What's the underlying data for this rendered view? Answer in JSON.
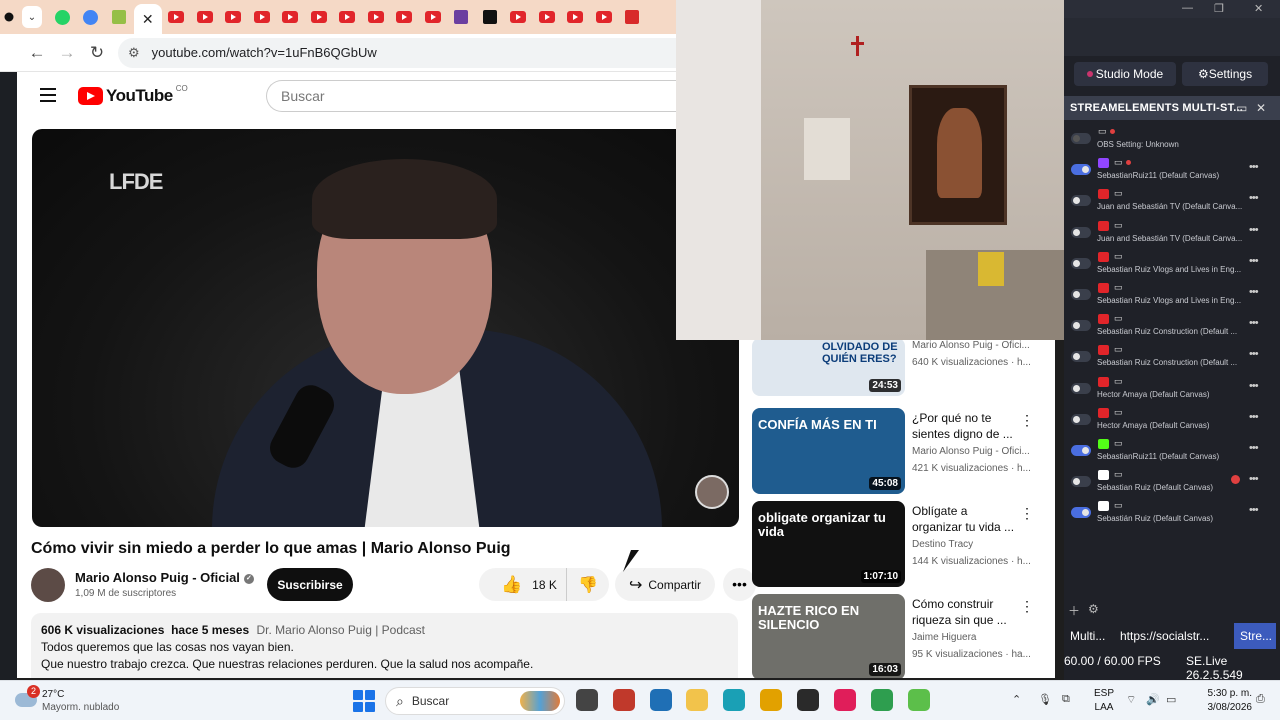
{
  "browser": {
    "tabs": [
      {
        "icon": "whatsapp-icon",
        "color": "#25d366",
        "kind": "round"
      },
      {
        "icon": "google-icon",
        "color": "#4285f4",
        "kind": "round"
      },
      {
        "icon": "shopify-icon",
        "color": "#95bf47",
        "kind": "sq"
      },
      {
        "icon": "close-icon",
        "color": "#222222",
        "kind": "active"
      },
      {
        "icon": "youtube-icon",
        "color": "#e1252a",
        "kind": "yt"
      },
      {
        "icon": "youtube-icon",
        "color": "#e1252a",
        "kind": "yt"
      },
      {
        "icon": "youtube-icon",
        "color": "#e1252a",
        "kind": "yt"
      },
      {
        "icon": "youtube-icon",
        "color": "#e1252a",
        "kind": "yt"
      },
      {
        "icon": "youtube-icon",
        "color": "#e1252a",
        "kind": "yt"
      },
      {
        "icon": "youtube-icon",
        "color": "#e1252a",
        "kind": "yt"
      },
      {
        "icon": "youtube-icon",
        "color": "#e1252a",
        "kind": "yt"
      },
      {
        "icon": "youtube-icon",
        "color": "#e1252a",
        "kind": "yt"
      },
      {
        "icon": "youtube-icon",
        "color": "#e1252a",
        "kind": "yt"
      },
      {
        "icon": "youtube-icon",
        "color": "#e1252a",
        "kind": "yt"
      },
      {
        "icon": "dollar-icon",
        "color": "#6b3fa0",
        "kind": "sq"
      },
      {
        "icon": "m-logo-icon",
        "color": "#111111",
        "kind": "sq"
      },
      {
        "icon": "youtube-icon",
        "color": "#e1252a",
        "kind": "yt"
      },
      {
        "icon": "youtube-icon",
        "color": "#e1252a",
        "kind": "yt"
      },
      {
        "icon": "youtube-icon",
        "color": "#e1252a",
        "kind": "yt"
      },
      {
        "icon": "youtube-icon",
        "color": "#e1252a",
        "kind": "yt"
      },
      {
        "icon": "record-icon",
        "color": "#d82a2a",
        "kind": "sq"
      }
    ],
    "url": "youtube.com/watch?v=1uFnB6QGbUw"
  },
  "youtube": {
    "logo_text": "YouTube",
    "country": "CO",
    "search_placeholder": "Buscar",
    "player_brand": "LFDE",
    "video_title": "Cómo vivir sin miedo a perder lo que amas | Mario Alonso Puig",
    "channel_name": "Mario Alonso Puig - Oficial",
    "channel_subs": "1,09 M de suscriptores",
    "subscribe_label": "Suscribirse",
    "like_count": "18 K",
    "share_label": "Compartir",
    "description": {
      "views": "606 K visualizaciones",
      "age": "hace 5 meses",
      "tag": "Dr. Mario Alonso Puig | Podcast",
      "line1": "Todos queremos que las cosas nos vayan bien.",
      "line2": "Que nuestro trabajo crezca. Que nuestras relaciones perduren. Que la salud nos acompañe."
    },
    "related": [
      {
        "thumb_text": "OLVIDADO DE QUIÉN ERES?",
        "thumb_bg": "#dfe7ef",
        "thumb_fg": "#0c3d7a",
        "duration": "24:53",
        "title": "",
        "channel": "Mario Alonso Puig - Ofici...",
        "views": "640 K visualizaciones · h..."
      },
      {
        "thumb_text": "CONFÍA MÁS EN TI",
        "thumb_bg": "#1f5c8f",
        "thumb_fg": "#ffffff",
        "duration": "45:08",
        "title": "¿Por qué no te sientes digno de ...",
        "channel": "Mario Alonso Puig - Ofici...",
        "views": "421 K visualizaciones · h..."
      },
      {
        "thumb_text": "obligate organizar tu vida",
        "thumb_bg": "#111111",
        "thumb_fg": "#ffffff",
        "duration": "1:07:10",
        "title": "Oblígate a organizar tu vida ...",
        "channel": "Destino Tracy",
        "views": "144 K visualizaciones · h..."
      },
      {
        "thumb_text": "HAZTE RICO EN SILENCIO",
        "thumb_bg": "#6f6f6a",
        "thumb_fg": "#ffffff",
        "duration": "16:03",
        "title": "Cómo construir riqueza sin que ...",
        "channel": "Jaime Higuera",
        "views": "95 K visualizaciones · ha..."
      }
    ]
  },
  "obs": {
    "studio_mode_label": "Studio Mode",
    "settings_label": "Settings",
    "dock_title": "STREAMELEMENTS MULTI-ST...",
    "rows": [
      {
        "enabled": false,
        "dim": true,
        "service": "",
        "service_color": "",
        "label": "OBS Setting: Unknown",
        "live": true
      },
      {
        "enabled": true,
        "service": "twitch-icon",
        "service_color": "#9146ff",
        "label": "SebastianRuiz11 (Default Canvas)",
        "live": true
      },
      {
        "enabled": false,
        "service": "youtube-icon",
        "service_color": "#e1252a",
        "label": "Juan and Sebastián TV (Default Canva...",
        "live": false
      },
      {
        "enabled": false,
        "service": "youtube-icon",
        "service_color": "#e1252a",
        "label": "Juan and Sebastián TV (Default Canva...",
        "live": false
      },
      {
        "enabled": false,
        "service": "youtube-icon",
        "service_color": "#e1252a",
        "label": "Sebastian Ruiz Vlogs and Lives in Eng...",
        "live": false
      },
      {
        "enabled": false,
        "service": "youtube-icon",
        "service_color": "#e1252a",
        "label": "Sebastian Ruiz Vlogs and Lives in Eng...",
        "live": false
      },
      {
        "enabled": false,
        "service": "youtube-icon",
        "service_color": "#e1252a",
        "label": "Sebastian Ruiz Construction (Default ...",
        "live": false
      },
      {
        "enabled": false,
        "service": "youtube-icon",
        "service_color": "#e1252a",
        "label": "Sebastian Ruiz Construction (Default ...",
        "live": false
      },
      {
        "enabled": false,
        "service": "youtube-icon",
        "service_color": "#e1252a",
        "label": "Hector Amaya (Default Canvas)",
        "live": false
      },
      {
        "enabled": false,
        "service": "youtube-icon",
        "service_color": "#e1252a",
        "label": "Hector Amaya (Default Canvas)",
        "live": false
      },
      {
        "enabled": true,
        "service": "kick-icon",
        "service_color": "#53fc18",
        "label": "SebastianRuiz11 (Default Canvas)",
        "live": false
      },
      {
        "enabled": false,
        "service": "tiktok-icon",
        "service_color": "#ffffff",
        "label": "Sebastian Ruiz (Default Canvas)",
        "live": false,
        "warning": true
      },
      {
        "enabled": true,
        "service": "x-icon",
        "service_color": "#ffffff",
        "label": "Sebastián Ruiz (Default Canvas)",
        "live": false
      }
    ],
    "tabs": [
      "Multi...",
      "https://socialstr...",
      "Stre..."
    ],
    "fps": "60.00 / 60.00 FPS",
    "version": "SE.Live 26.2.5.549"
  },
  "taskbar": {
    "weather_temp": "27°C",
    "weather_desc": "Mayorm. nublado",
    "weather_badge": "2",
    "search_label": "Buscar",
    "lang1": "ESP",
    "lang2": "LAA",
    "time": "5:30 p. m.",
    "date": "3/08/2026",
    "apps": [
      {
        "name": "task-view-icon",
        "color": "#444444"
      },
      {
        "name": "brave-icon",
        "color": "#c0392b"
      },
      {
        "name": "store-icon",
        "color": "#1f6fb5"
      },
      {
        "name": "explorer-icon",
        "color": "#f2c34b"
      },
      {
        "name": "edge-icon",
        "color": "#1aa0b5"
      },
      {
        "name": "chrome-icon",
        "color": "#e2a100"
      },
      {
        "name": "obs-icon",
        "color": "#2a2a2a"
      },
      {
        "name": "tiktok-icon",
        "color": "#e01e5a"
      },
      {
        "name": "chrome-profile-icon",
        "color": "#2e9e4f"
      },
      {
        "name": "greenshot-icon",
        "color": "#5cbf4a"
      }
    ]
  }
}
